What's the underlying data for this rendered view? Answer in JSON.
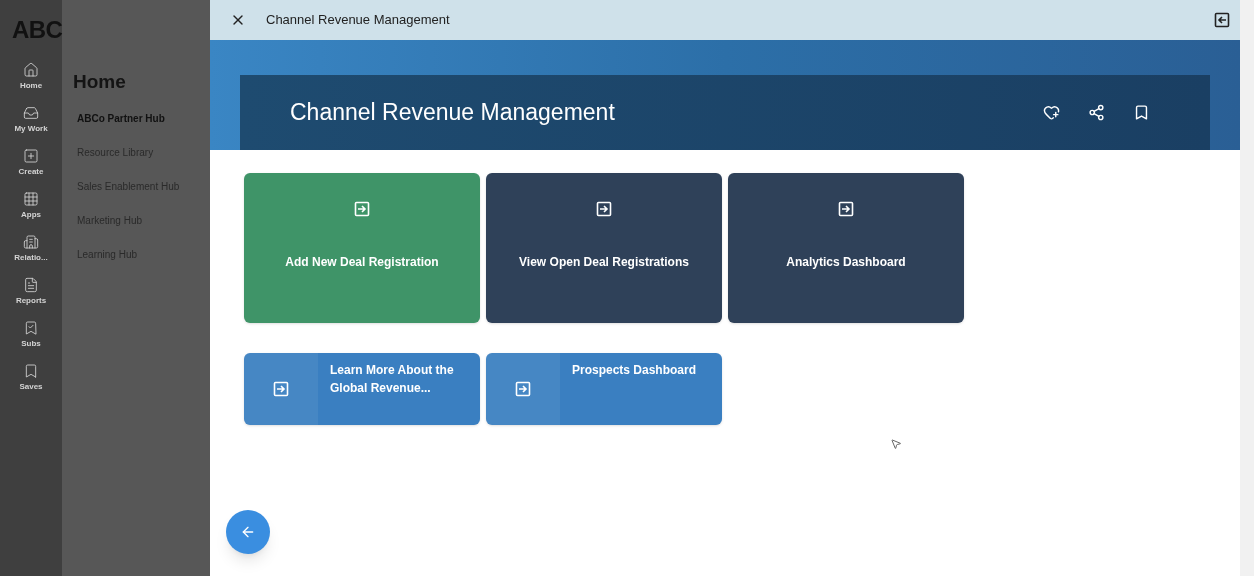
{
  "brand": {
    "logo": "ABC"
  },
  "rail": [
    {
      "label": "Home"
    },
    {
      "label": "My Work"
    },
    {
      "label": "Create"
    },
    {
      "label": "Apps"
    },
    {
      "label": "Relatio..."
    },
    {
      "label": "Reports"
    },
    {
      "label": "Subs"
    },
    {
      "label": "Saves"
    }
  ],
  "menu": {
    "title": "Home",
    "items": [
      {
        "label": "ABCo Partner Hub",
        "selected": true
      },
      {
        "label": "Resource Library",
        "selected": false
      },
      {
        "label": "Sales Enablement Hub",
        "selected": false
      },
      {
        "label": "Marketing Hub",
        "selected": false
      },
      {
        "label": "Learning Hub",
        "selected": false
      }
    ]
  },
  "window": {
    "title": "Channel Revenue Management"
  },
  "banner": {
    "title": "Channel Revenue Management"
  },
  "tiles": [
    {
      "label": "Add New Deal Registration",
      "kind": "large",
      "color": "#3f9468"
    },
    {
      "label": "View Open Deal Registrations",
      "kind": "large",
      "color": "#2f4159"
    },
    {
      "label": "Analytics Dashboard",
      "kind": "large",
      "color": "#2f4159"
    },
    {
      "label": "Learn More About the Global Revenue...",
      "kind": "small",
      "color": "#3a7fc1"
    },
    {
      "label": "Prospects Dashboard",
      "kind": "small",
      "color": "#3a7fc1"
    }
  ]
}
